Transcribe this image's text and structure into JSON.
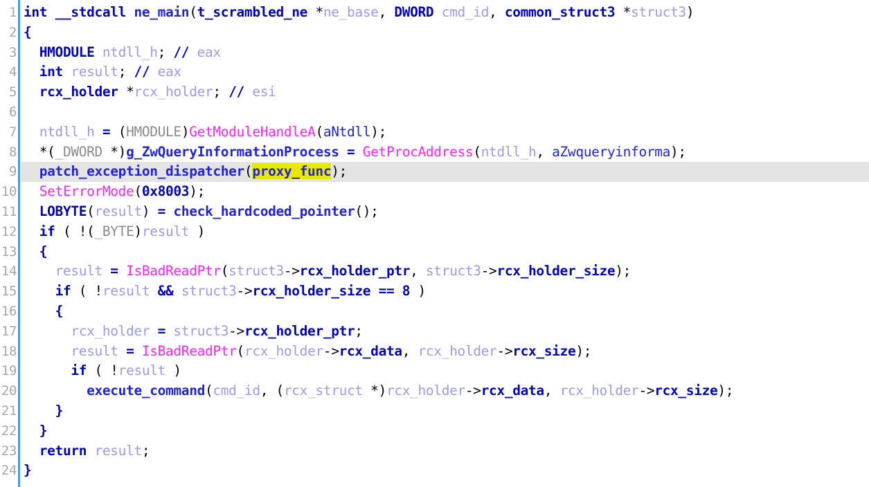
{
  "view": {
    "name": "hex-rays-pseudocode",
    "function_name": "ne_main",
    "total_lines": 24,
    "current_line": 9,
    "highlighted_token": "proxy_func",
    "colors": {
      "background": "#ffffff",
      "gutter_text": "#a8a8a8",
      "separator": "#4a9ade",
      "current_line_bg": "#e4e4e4",
      "highlight_bg": "#e8e800",
      "keyword": "#0000c0",
      "local_var": "#9a9aee",
      "user_function": "#2222dd",
      "api_function": "#ff24ff",
      "macro_gray": "#8a8a8a",
      "comment": "#9a9aee"
    }
  },
  "gutter": {
    "numbers": [
      "1",
      "2",
      "3",
      "4",
      "5",
      "6",
      "7",
      "8",
      "9",
      "10",
      "11",
      "12",
      "13",
      "14",
      "15",
      "16",
      "17",
      "18",
      "19",
      "20",
      "21",
      "22",
      "23",
      "24"
    ]
  },
  "code": {
    "lines": [
      {
        "number": 1,
        "current": false,
        "tokens": [
          {
            "t": "int",
            "c": "t-keyword"
          },
          {
            "t": " ",
            "c": "t-punct"
          },
          {
            "t": "__stdcall",
            "c": "t-keyword"
          },
          {
            "t": " ",
            "c": "t-punct"
          },
          {
            "t": "ne_main",
            "c": "t-func"
          },
          {
            "t": "(",
            "c": "t-punct"
          },
          {
            "t": "t_scrambled_ne",
            "c": "t-type"
          },
          {
            "t": " *",
            "c": "t-punct"
          },
          {
            "t": "ne_base",
            "c": "t-local"
          },
          {
            "t": ", ",
            "c": "t-punct"
          },
          {
            "t": "DWORD",
            "c": "t-type"
          },
          {
            "t": " ",
            "c": "t-punct"
          },
          {
            "t": "cmd_id",
            "c": "t-local"
          },
          {
            "t": ", ",
            "c": "t-punct"
          },
          {
            "t": "common_struct3",
            "c": "t-type"
          },
          {
            "t": " *",
            "c": "t-punct"
          },
          {
            "t": "struct3",
            "c": "t-local"
          },
          {
            "t": ")",
            "c": "t-punct"
          }
        ]
      },
      {
        "number": 2,
        "current": false,
        "tokens": [
          {
            "t": "{",
            "c": "t-brace"
          }
        ]
      },
      {
        "number": 3,
        "current": false,
        "tokens": [
          {
            "t": "  ",
            "c": "t-punct"
          },
          {
            "t": "HMODULE",
            "c": "t-type"
          },
          {
            "t": " ",
            "c": "t-punct"
          },
          {
            "t": "ntdll_h",
            "c": "t-local"
          },
          {
            "t": "; ",
            "c": "t-punct"
          },
          {
            "t": "//",
            "c": "t-keyword"
          },
          {
            "t": " eax",
            "c": "t-comment"
          }
        ]
      },
      {
        "number": 4,
        "current": false,
        "tokens": [
          {
            "t": "  ",
            "c": "t-punct"
          },
          {
            "t": "int",
            "c": "t-keyword"
          },
          {
            "t": " ",
            "c": "t-punct"
          },
          {
            "t": "result",
            "c": "t-local"
          },
          {
            "t": "; ",
            "c": "t-punct"
          },
          {
            "t": "//",
            "c": "t-keyword"
          },
          {
            "t": " eax",
            "c": "t-comment"
          }
        ]
      },
      {
        "number": 5,
        "current": false,
        "tokens": [
          {
            "t": "  ",
            "c": "t-punct"
          },
          {
            "t": "rcx_holder",
            "c": "t-type"
          },
          {
            "t": " *",
            "c": "t-punct"
          },
          {
            "t": "rcx_holder",
            "c": "t-local"
          },
          {
            "t": "; ",
            "c": "t-punct"
          },
          {
            "t": "//",
            "c": "t-keyword"
          },
          {
            "t": " esi",
            "c": "t-comment"
          }
        ]
      },
      {
        "number": 6,
        "current": false,
        "tokens": []
      },
      {
        "number": 7,
        "current": false,
        "tokens": [
          {
            "t": "  ",
            "c": "t-punct"
          },
          {
            "t": "ntdll_h",
            "c": "t-local"
          },
          {
            "t": " = ",
            "c": "t-keyword"
          },
          {
            "t": "(",
            "c": "t-punct"
          },
          {
            "t": "HMODULE",
            "c": "t-gray"
          },
          {
            "t": ")",
            "c": "t-punct"
          },
          {
            "t": "GetModuleHandleA",
            "c": "t-api"
          },
          {
            "t": "(",
            "c": "t-punct"
          },
          {
            "t": "aNtdll",
            "c": "t-string"
          },
          {
            "t": ");",
            "c": "t-punct"
          }
        ]
      },
      {
        "number": 8,
        "current": false,
        "tokens": [
          {
            "t": "  *(",
            "c": "t-punct"
          },
          {
            "t": "_DWORD",
            "c": "t-gray"
          },
          {
            "t": " *)",
            "c": "t-punct"
          },
          {
            "t": "g_ZwQueryInformationProcess",
            "c": "t-func"
          },
          {
            "t": " = ",
            "c": "t-keyword"
          },
          {
            "t": "GetProcAddress",
            "c": "t-api"
          },
          {
            "t": "(",
            "c": "t-punct"
          },
          {
            "t": "ntdll_h",
            "c": "t-local"
          },
          {
            "t": ", ",
            "c": "t-punct"
          },
          {
            "t": "aZwqueryinforma",
            "c": "t-string"
          },
          {
            "t": ");",
            "c": "t-punct"
          }
        ]
      },
      {
        "number": 9,
        "current": true,
        "tokens": [
          {
            "t": "  ",
            "c": "t-punct"
          },
          {
            "t": "patch_exception_dispatcher",
            "c": "t-func"
          },
          {
            "t": "(",
            "c": "t-punct"
          },
          {
            "t": "proxy_func",
            "c": "t-func t-highlight"
          },
          {
            "t": ");",
            "c": "t-punct"
          }
        ]
      },
      {
        "number": 10,
        "current": false,
        "tokens": [
          {
            "t": "  ",
            "c": "t-punct"
          },
          {
            "t": "SetErrorMode",
            "c": "t-api"
          },
          {
            "t": "(",
            "c": "t-punct"
          },
          {
            "t": "0x8003",
            "c": "t-number"
          },
          {
            "t": ");",
            "c": "t-punct"
          }
        ]
      },
      {
        "number": 11,
        "current": false,
        "tokens": [
          {
            "t": "  ",
            "c": "t-punct"
          },
          {
            "t": "LOBYTE",
            "c": "t-keyword"
          },
          {
            "t": "(",
            "c": "t-punct"
          },
          {
            "t": "result",
            "c": "t-local"
          },
          {
            "t": ")",
            "c": "t-punct"
          },
          {
            "t": " = ",
            "c": "t-keyword"
          },
          {
            "t": "check_hardcoded_pointer",
            "c": "t-func"
          },
          {
            "t": "();",
            "c": "t-punct"
          }
        ]
      },
      {
        "number": 12,
        "current": false,
        "tokens": [
          {
            "t": "  ",
            "c": "t-punct"
          },
          {
            "t": "if",
            "c": "t-keyword"
          },
          {
            "t": " ( !(",
            "c": "t-punct"
          },
          {
            "t": "_BYTE",
            "c": "t-gray"
          },
          {
            "t": ")",
            "c": "t-punct"
          },
          {
            "t": "result",
            "c": "t-local"
          },
          {
            "t": " )",
            "c": "t-punct"
          }
        ]
      },
      {
        "number": 13,
        "current": false,
        "tokens": [
          {
            "t": "  ",
            "c": "t-punct"
          },
          {
            "t": "{",
            "c": "t-brace"
          }
        ]
      },
      {
        "number": 14,
        "current": false,
        "tokens": [
          {
            "t": "    ",
            "c": "t-punct"
          },
          {
            "t": "result",
            "c": "t-local"
          },
          {
            "t": " = ",
            "c": "t-keyword"
          },
          {
            "t": "IsBadReadPtr",
            "c": "t-api"
          },
          {
            "t": "(",
            "c": "t-punct"
          },
          {
            "t": "struct3",
            "c": "t-local"
          },
          {
            "t": "->",
            "c": "t-punct"
          },
          {
            "t": "rcx_holder_ptr",
            "c": "t-member"
          },
          {
            "t": ", ",
            "c": "t-punct"
          },
          {
            "t": "struct3",
            "c": "t-local"
          },
          {
            "t": "->",
            "c": "t-punct"
          },
          {
            "t": "rcx_holder_size",
            "c": "t-member"
          },
          {
            "t": ");",
            "c": "t-punct"
          }
        ]
      },
      {
        "number": 15,
        "current": false,
        "tokens": [
          {
            "t": "    ",
            "c": "t-punct"
          },
          {
            "t": "if",
            "c": "t-keyword"
          },
          {
            "t": " ( !",
            "c": "t-punct"
          },
          {
            "t": "result",
            "c": "t-local"
          },
          {
            "t": " && ",
            "c": "t-keyword"
          },
          {
            "t": "struct3",
            "c": "t-local"
          },
          {
            "t": "->",
            "c": "t-punct"
          },
          {
            "t": "rcx_holder_size",
            "c": "t-member"
          },
          {
            "t": " == ",
            "c": "t-keyword"
          },
          {
            "t": "8",
            "c": "t-number"
          },
          {
            "t": " )",
            "c": "t-punct"
          }
        ]
      },
      {
        "number": 16,
        "current": false,
        "tokens": [
          {
            "t": "    ",
            "c": "t-punct"
          },
          {
            "t": "{",
            "c": "t-brace"
          }
        ]
      },
      {
        "number": 17,
        "current": false,
        "tokens": [
          {
            "t": "      ",
            "c": "t-punct"
          },
          {
            "t": "rcx_holder",
            "c": "t-local"
          },
          {
            "t": " = ",
            "c": "t-keyword"
          },
          {
            "t": "struct3",
            "c": "t-local"
          },
          {
            "t": "->",
            "c": "t-punct"
          },
          {
            "t": "rcx_holder_ptr",
            "c": "t-member"
          },
          {
            "t": ";",
            "c": "t-punct"
          }
        ]
      },
      {
        "number": 18,
        "current": false,
        "tokens": [
          {
            "t": "      ",
            "c": "t-punct"
          },
          {
            "t": "result",
            "c": "t-local"
          },
          {
            "t": " = ",
            "c": "t-keyword"
          },
          {
            "t": "IsBadReadPtr",
            "c": "t-api"
          },
          {
            "t": "(",
            "c": "t-punct"
          },
          {
            "t": "rcx_holder",
            "c": "t-local"
          },
          {
            "t": "->",
            "c": "t-punct"
          },
          {
            "t": "rcx_data",
            "c": "t-member"
          },
          {
            "t": ", ",
            "c": "t-punct"
          },
          {
            "t": "rcx_holder",
            "c": "t-local"
          },
          {
            "t": "->",
            "c": "t-punct"
          },
          {
            "t": "rcx_size",
            "c": "t-member"
          },
          {
            "t": ");",
            "c": "t-punct"
          }
        ]
      },
      {
        "number": 19,
        "current": false,
        "tokens": [
          {
            "t": "      ",
            "c": "t-punct"
          },
          {
            "t": "if",
            "c": "t-keyword"
          },
          {
            "t": " ( !",
            "c": "t-punct"
          },
          {
            "t": "result",
            "c": "t-local"
          },
          {
            "t": " )",
            "c": "t-punct"
          }
        ]
      },
      {
        "number": 20,
        "current": false,
        "tokens": [
          {
            "t": "        ",
            "c": "t-punct"
          },
          {
            "t": "execute_command",
            "c": "t-func"
          },
          {
            "t": "(",
            "c": "t-punct"
          },
          {
            "t": "cmd_id",
            "c": "t-local"
          },
          {
            "t": ", (",
            "c": "t-punct"
          },
          {
            "t": "rcx_struct",
            "c": "t-local"
          },
          {
            "t": " *)",
            "c": "t-punct"
          },
          {
            "t": "rcx_holder",
            "c": "t-local"
          },
          {
            "t": "->",
            "c": "t-punct"
          },
          {
            "t": "rcx_data",
            "c": "t-member"
          },
          {
            "t": ", ",
            "c": "t-punct"
          },
          {
            "t": "rcx_holder",
            "c": "t-local"
          },
          {
            "t": "->",
            "c": "t-punct"
          },
          {
            "t": "rcx_size",
            "c": "t-member"
          },
          {
            "t": ");",
            "c": "t-punct"
          }
        ]
      },
      {
        "number": 21,
        "current": false,
        "tokens": [
          {
            "t": "    ",
            "c": "t-punct"
          },
          {
            "t": "}",
            "c": "t-brace"
          }
        ]
      },
      {
        "number": 22,
        "current": false,
        "tokens": [
          {
            "t": "  ",
            "c": "t-punct"
          },
          {
            "t": "}",
            "c": "t-brace"
          }
        ]
      },
      {
        "number": 23,
        "current": false,
        "tokens": [
          {
            "t": "  ",
            "c": "t-punct"
          },
          {
            "t": "return",
            "c": "t-keyword"
          },
          {
            "t": " ",
            "c": "t-punct"
          },
          {
            "t": "result",
            "c": "t-local"
          },
          {
            "t": ";",
            "c": "t-punct"
          }
        ]
      },
      {
        "number": 24,
        "current": false,
        "tokens": [
          {
            "t": "}",
            "c": "t-brace"
          }
        ]
      }
    ]
  }
}
